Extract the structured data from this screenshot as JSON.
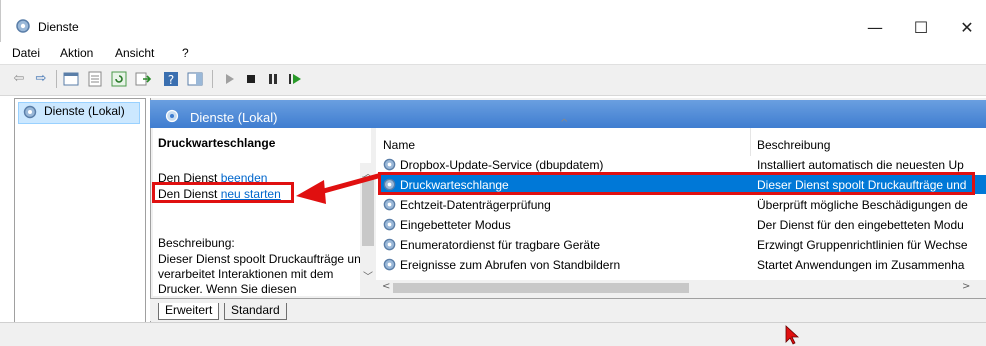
{
  "window": {
    "title": "Dienste",
    "minimize": "—",
    "maximize": "☐",
    "close": "✕"
  },
  "menu": {
    "datei": "Datei",
    "aktion": "Aktion",
    "ansicht": "Ansicht",
    "help": "?"
  },
  "tree": {
    "item": "Dienste (Lokal)"
  },
  "header": {
    "title": "Dienste (Lokal)"
  },
  "details": {
    "service_name": "Druckwarteschlange",
    "stop_prefix": "Den Dienst ",
    "stop_link": "beenden",
    "restart_prefix": "Den Dienst ",
    "restart_link": "neu starten",
    "desc_label": "Beschreibung:",
    "desc_body": "Dieser Dienst spoolt Druckaufträge und verarbeitet Interaktionen mit dem Drucker. Wenn Sie diesen"
  },
  "list": {
    "col_name": "Name",
    "col_desc": "Beschreibung",
    "rows": [
      {
        "name": "Dropbox-Update-Service (dbupdatem)",
        "desc": "Installiert automatisch die neuesten Up"
      },
      {
        "name": "Druckwarteschlange",
        "desc": "Dieser Dienst spoolt Druckaufträge und"
      },
      {
        "name": "Echtzeit-Datenträgerprüfung",
        "desc": "Überprüft mögliche Beschädigungen de"
      },
      {
        "name": "Eingebetteter Modus",
        "desc": "Der Dienst für den eingebetteten Modu"
      },
      {
        "name": "Enumeratordienst für tragbare Geräte",
        "desc": "Erzwingt Gruppenrichtlinien für Wechse"
      },
      {
        "name": "Ereignisse zum Abrufen von Standbildern",
        "desc": "Startet Anwendungen im Zusammenha"
      }
    ],
    "selected_index": 1
  },
  "tabs": {
    "extended": "Erweitert",
    "standard": "Standard"
  },
  "colors": {
    "accent": "#0078d7",
    "header_band": "#3f7dd0",
    "highlight_box": "#e01010",
    "link": "#0066cc"
  }
}
